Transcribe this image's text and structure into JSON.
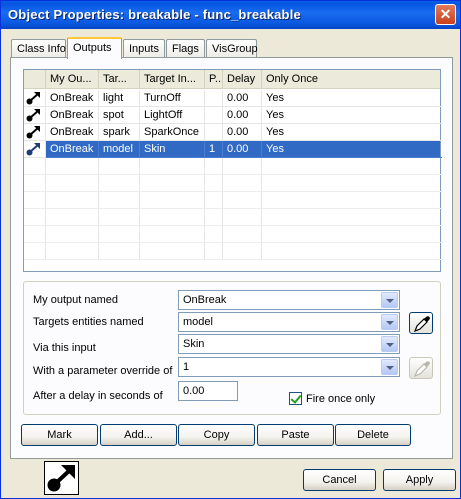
{
  "window": {
    "title": "Object Properties: breakable - func_breakable",
    "close_glyph": "✕"
  },
  "tabs": [
    {
      "label": "Class Info",
      "active": false
    },
    {
      "label": "Outputs",
      "active": true
    },
    {
      "label": "Inputs",
      "active": false
    },
    {
      "label": "Flags",
      "active": false
    },
    {
      "label": "VisGroup",
      "active": false
    }
  ],
  "outputs_table": {
    "columns": [
      "",
      "My Ou...",
      "Tar...",
      "Target In...",
      "P...",
      "Delay",
      "Only Once"
    ],
    "rows": [
      {
        "icon": "output-arrow-icon",
        "output": "OnBreak",
        "target": "light",
        "input": "TurnOff",
        "param": "",
        "delay": "0.00",
        "once": "Yes",
        "selected": false
      },
      {
        "icon": "output-arrow-icon",
        "output": "OnBreak",
        "target": "spot",
        "input": "LightOff",
        "param": "",
        "delay": "0.00",
        "once": "Yes",
        "selected": false
      },
      {
        "icon": "output-arrow-icon",
        "output": "OnBreak",
        "target": "spark",
        "input": "SparkOnce",
        "param": "",
        "delay": "0.00",
        "once": "Yes",
        "selected": false
      },
      {
        "icon": "output-arrow-icon",
        "output": "OnBreak",
        "target": "model",
        "input": "Skin",
        "param": "1",
        "delay": "0.00",
        "once": "Yes",
        "selected": true
      }
    ]
  },
  "form": {
    "output_label": "My output named",
    "output_value": "OnBreak",
    "targets_label": "Targets entities named",
    "targets_value": "model",
    "input_label": "Via this input",
    "input_value": "Skin",
    "param_label": "With a parameter override of",
    "param_value": "1",
    "delay_label": "After a delay in seconds of",
    "delay_value": "0.00",
    "fire_once_label": "Fire once only",
    "fire_once_checked": true
  },
  "action_buttons": {
    "mark": "Mark",
    "add": "Add...",
    "copy": "Copy",
    "paste": "Paste",
    "delete": "Delete"
  },
  "footer": {
    "cancel": "Cancel",
    "apply": "Apply"
  },
  "colors": {
    "selection": "#316AC5",
    "titlebar": "#0A58E0"
  }
}
